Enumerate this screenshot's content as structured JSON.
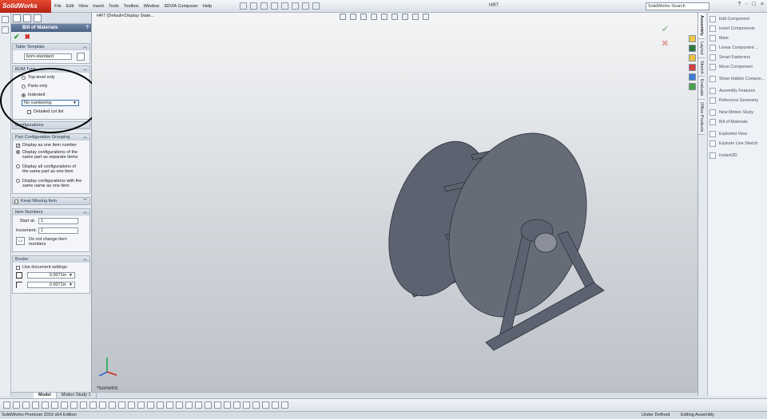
{
  "menubar": {
    "logo": "SolidWorks",
    "menus": [
      "File",
      "Edit",
      "View",
      "Insert",
      "Tools",
      "Toolbox",
      "Window",
      "3DVIA Composer",
      "Help"
    ],
    "window_title": "HR7",
    "search_placeholder": "SolidWorks Search",
    "window_controls": [
      "?",
      "-",
      "□",
      "×"
    ]
  },
  "property_manager": {
    "title": "Bill of Materials",
    "help": "?",
    "table_template": {
      "header": "Table Template",
      "value": "bom-standard"
    },
    "bom_type": {
      "header": "BOM Type",
      "options": [
        "Top-level only",
        "Parts only",
        "Indented"
      ],
      "selected": "Indented",
      "numbering_value": "No numbering",
      "detailed_cut_list": "Detailed cut list"
    },
    "configurations": {
      "header": "Configurations"
    },
    "part_config_grouping": {
      "header": "Part Configuration Grouping",
      "display_one_item": "Display as one item number",
      "options": [
        "Display configurations of the same part as separate items",
        "Display all configurations of the same part as one item",
        "Display configurations with the same name as one item"
      ]
    },
    "keep_missing": {
      "header": "Keep Missing Item"
    },
    "item_numbers": {
      "header": "Item Numbers",
      "start_label": "Start at:",
      "start_value": "1",
      "increment_label": "Increment:",
      "increment_value": "1",
      "do_not_change": "Do not change item numbers"
    },
    "border": {
      "header": "Border",
      "use_doc": "Use document settings",
      "box_value": "0.0071in",
      "grid_value": "0.0071in"
    }
  },
  "graphics": {
    "doc_title": "HR7  (Default<Display State...",
    "view_name": "*Isometric"
  },
  "task_tabs": [
    "Assembly",
    "Layout",
    "Sketch",
    "Evaluate",
    "Office Products"
  ],
  "command_manager": {
    "items": [
      "Edit Component",
      "Insert Components",
      "Mate",
      "Linear Component ...",
      "Smart Fasteners",
      "Move Component",
      "Show Hidden Compon...",
      "Assembly Features",
      "Reference Geometry",
      "New Motion Study",
      "Bill of Materials",
      "Exploded View",
      "Explode Line Sketch",
      "Instant3D"
    ]
  },
  "model_tabs": [
    "Model",
    "Motion Study 1"
  ],
  "status": {
    "app": "SolidWorks Premium 2010 x64 Edition",
    "state": "Under Defined",
    "mode": "Editing Assembly"
  },
  "colors": {
    "accent": "#4b6284",
    "ok": "#1d9b2a",
    "cancel": "#d12323",
    "model": "#5d6270"
  }
}
